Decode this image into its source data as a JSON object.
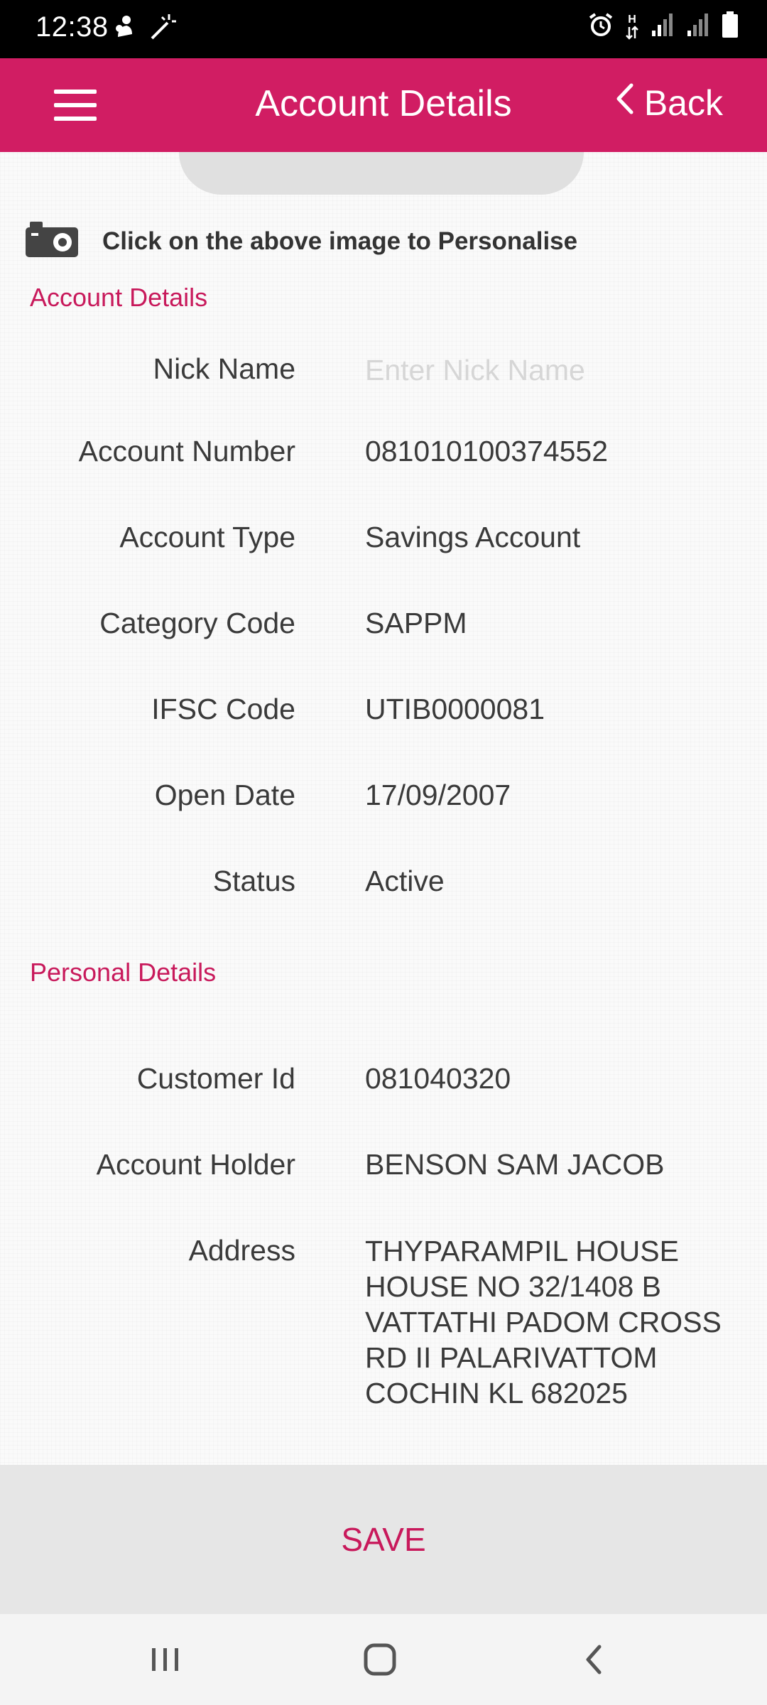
{
  "status_bar": {
    "time": "12:38",
    "left_icons": [
      "notification-icon",
      "magic-wand-icon"
    ],
    "right_icons": [
      "alarm-icon",
      "data-transfer-icon",
      "signal-icon",
      "signal-icon-2",
      "battery-icon"
    ],
    "network_label": "H"
  },
  "header": {
    "title": "Account Details",
    "back_label": "Back",
    "brand_color": "#d11d63"
  },
  "personalise": {
    "text": "Click on the above image to Personalise",
    "icon": "camera-icon"
  },
  "account_section": {
    "title": "Account Details",
    "nick_name_label": "Nick Name",
    "nick_name_placeholder": "Enter Nick Name",
    "nick_name_value": "",
    "fields": [
      {
        "label": "Account Number",
        "value": "081010100374552"
      },
      {
        "label": "Account Type",
        "value": "Savings Account"
      },
      {
        "label": "Category Code",
        "value": "SAPPM"
      },
      {
        "label": "IFSC Code",
        "value": "UTIB0000081"
      },
      {
        "label": "Open Date",
        "value": "17/09/2007"
      },
      {
        "label": "Status",
        "value": "Active"
      }
    ]
  },
  "personal_section": {
    "title": "Personal Details",
    "fields": [
      {
        "label": "Customer Id",
        "value": "081040320"
      },
      {
        "label": "Account Holder",
        "value": "BENSON SAM JACOB"
      }
    ],
    "address_label": "Address",
    "address_lines": [
      "THYPARAMPIL HOUSE",
      "HOUSE NO 32/1408 B",
      "VATTATHI PADOM CROSS",
      "RD II PALARIVATTOM",
      "COCHIN KL 682025"
    ]
  },
  "save_label": "SAVE",
  "nav": {
    "recents": "recents-icon",
    "home": "home-icon",
    "back": "back-icon"
  }
}
